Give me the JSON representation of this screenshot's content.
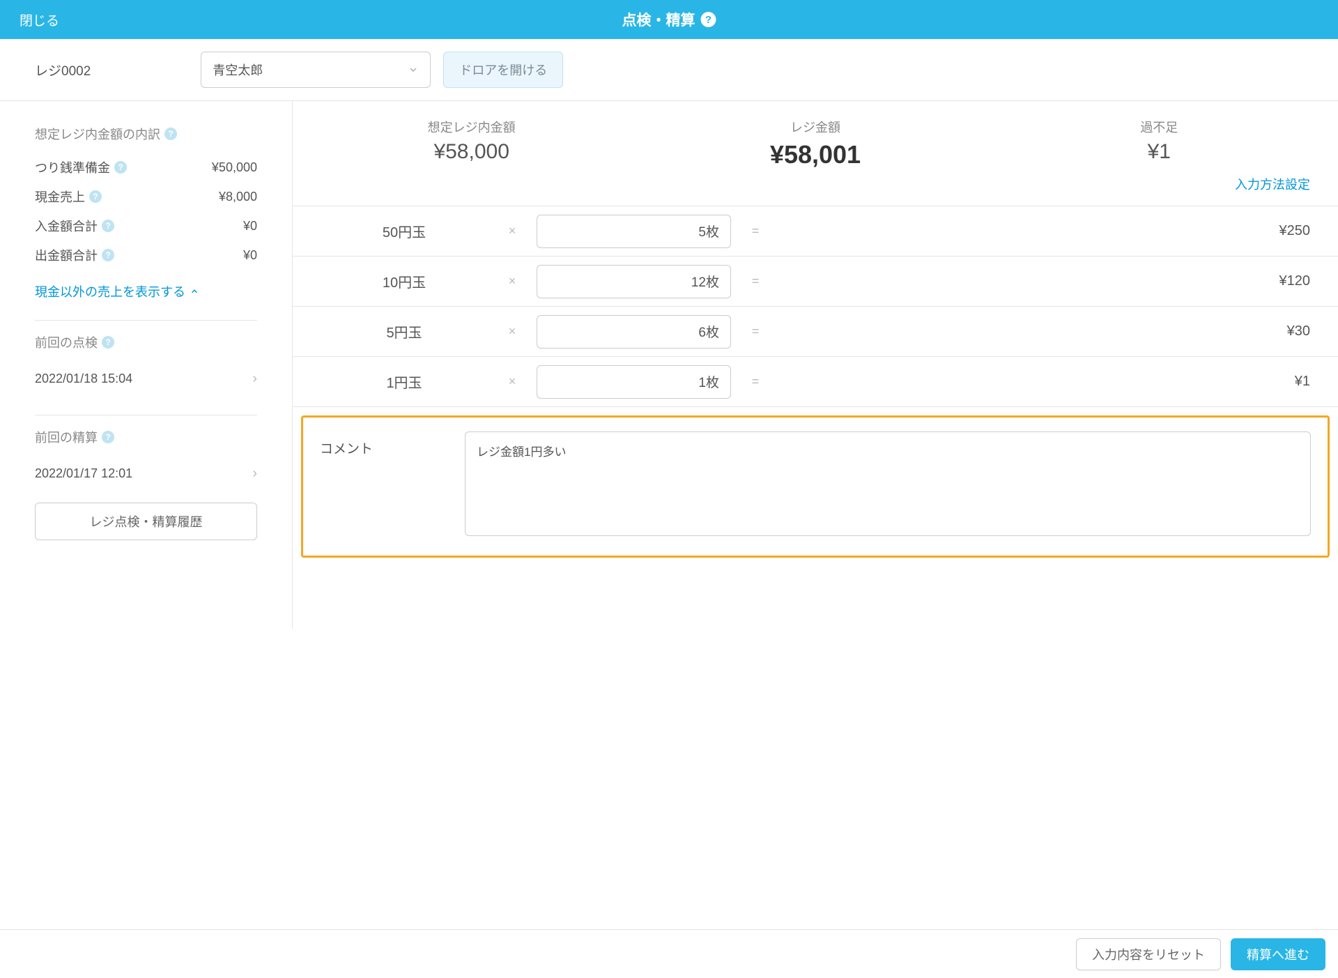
{
  "header": {
    "close": "閉じる",
    "title": "点検・精算"
  },
  "subheader": {
    "register": "レジ0002",
    "staff": "青空太郎",
    "drawer_button": "ドロアを開ける"
  },
  "sidebar": {
    "breakdown_title": "想定レジ内金額の内訳",
    "rows": [
      {
        "label": "つり銭準備金",
        "value": "¥50,000"
      },
      {
        "label": "現金売上",
        "value": "¥8,000"
      },
      {
        "label": "入金額合計",
        "value": "¥0"
      },
      {
        "label": "出金額合計",
        "value": "¥0"
      }
    ],
    "expand_link": "現金以外の売上を表示する",
    "last_check_title": "前回の点検",
    "last_check_time": "2022/01/18 15:04",
    "last_settle_title": "前回の精算",
    "last_settle_time": "2022/01/17 12:01",
    "history_button": "レジ点検・精算履歴"
  },
  "summary": {
    "expected_label": "想定レジ内金額",
    "expected_value": "¥58,000",
    "actual_label": "レジ金額",
    "actual_value": "¥58,001",
    "diff_label": "過不足",
    "diff_value": "¥1",
    "input_method_link": "入力方法設定"
  },
  "denominations": [
    {
      "label": "50円玉",
      "count": "5枚",
      "amount": "¥250"
    },
    {
      "label": "10円玉",
      "count": "12枚",
      "amount": "¥120"
    },
    {
      "label": "5円玉",
      "count": "6枚",
      "amount": "¥30"
    },
    {
      "label": "1円玉",
      "count": "1枚",
      "amount": "¥1"
    }
  ],
  "comment": {
    "label": "コメント",
    "value": "レジ金額1円多い"
  },
  "footer": {
    "reset": "入力内容をリセット",
    "proceed": "精算へ進む"
  }
}
